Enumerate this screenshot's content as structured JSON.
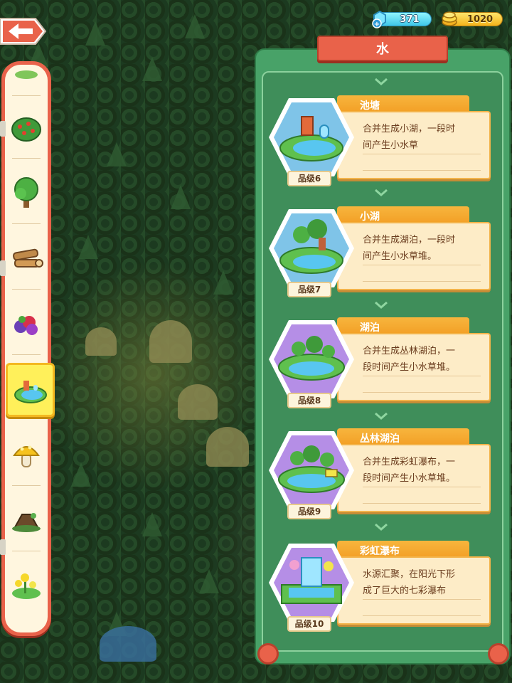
{
  "currency": {
    "gems": "371",
    "gold": "1020"
  },
  "panel": {
    "title": "水"
  },
  "sidebar": {
    "items": [
      {
        "icon": "grass-tuft-icon"
      },
      {
        "icon": "berry-bush-icon"
      },
      {
        "icon": "tree-icon"
      },
      {
        "icon": "wood-logs-icon"
      },
      {
        "icon": "berries-icon"
      },
      {
        "icon": "pond-icon",
        "selected": true
      },
      {
        "icon": "mushroom-icon"
      },
      {
        "icon": "tree-stump-icon"
      },
      {
        "icon": "flowers-icon"
      }
    ]
  },
  "cards": [
    {
      "name": "池塘",
      "desc": "合并生成小湖，一段时\n间产生小水草",
      "grade": "品级6",
      "hex_color": "#7fc4e8"
    },
    {
      "name": "小湖",
      "desc": "合并生成湖泊，一段时\n间产生小水草堆。",
      "grade": "品级7",
      "hex_color": "#7fc4e8"
    },
    {
      "name": "湖泊",
      "desc": "合并生成丛林湖泊，一\n段时间产生小水草堆。",
      "grade": "品级8",
      "hex_color": "#b58ee6"
    },
    {
      "name": "丛林湖泊",
      "desc": "合并生成彩虹瀑布，一\n段时间产生小水草堆。",
      "grade": "品级9",
      "hex_color": "#b58ee6"
    },
    {
      "name": "彩虹瀑布",
      "desc": "水源汇聚，在阳光下形\n成了巨大的七彩瀑布",
      "grade": "品级10",
      "hex_color": "#b58ee6"
    }
  ],
  "colors": {
    "panel_green": "#48a268",
    "banner_red": "#e9624a",
    "name_orange": "#f29c22",
    "desc_cream": "#fdecc7"
  }
}
